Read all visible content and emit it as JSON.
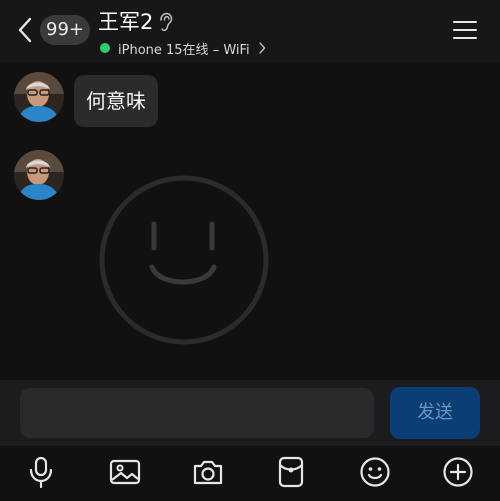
{
  "header": {
    "unread_count": "99+",
    "contact_name": "王军2",
    "status_text": "iPhone 15在线 – WiFi",
    "online_color": "#2ccf6a",
    "icons": [
      "back-arrow-icon",
      "ear-icon",
      "chevron-right-icon",
      "menu-icon"
    ]
  },
  "messages": [
    {
      "sender": "contact",
      "type": "text",
      "text": "何意味"
    },
    {
      "sender": "contact",
      "type": "emoji",
      "emoji": "smile-face"
    }
  ],
  "composer": {
    "input_value": "",
    "send_label": "发送",
    "send_color": "#0a3e74"
  },
  "toolbar": {
    "icons": [
      "microphone-icon",
      "image-icon",
      "camera-icon",
      "red-packet-icon",
      "emoji-icon",
      "plus-icon"
    ]
  }
}
